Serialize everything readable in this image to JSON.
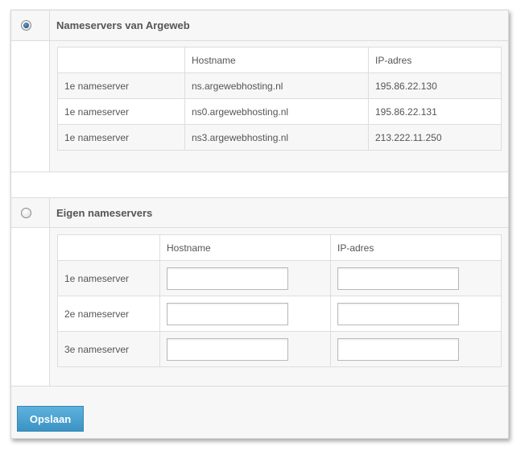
{
  "argeweb_section": {
    "title": "Nameservers van Argeweb",
    "selected": true,
    "columns": [
      "",
      "Hostname",
      "IP-adres"
    ],
    "rows": [
      {
        "label": "1e nameserver",
        "hostname": "ns.argewebhosting.nl",
        "ip": "195.86.22.130"
      },
      {
        "label": "1e nameserver",
        "hostname": "ns0.argewebhosting.nl",
        "ip": "195.86.22.131"
      },
      {
        "label": "1e nameserver",
        "hostname": "ns3.argewebhosting.nl",
        "ip": "213.222.11.250"
      }
    ]
  },
  "custom_section": {
    "title": "Eigen nameservers",
    "selected": false,
    "columns": [
      "",
      "Hostname",
      "IP-adres"
    ],
    "rows": [
      {
        "label": "1e nameserver",
        "hostname_value": "",
        "ip_value": ""
      },
      {
        "label": "2e nameserver",
        "hostname_value": "",
        "ip_value": ""
      },
      {
        "label": "3e nameserver",
        "hostname_value": "",
        "ip_value": ""
      }
    ]
  },
  "footer": {
    "save_label": "Opslaan"
  },
  "colors": {
    "button_bg": "#4aa3d2",
    "radio_selected": "#1f4f86",
    "border": "#dddddd",
    "panel_bg": "#f7f7f7"
  }
}
